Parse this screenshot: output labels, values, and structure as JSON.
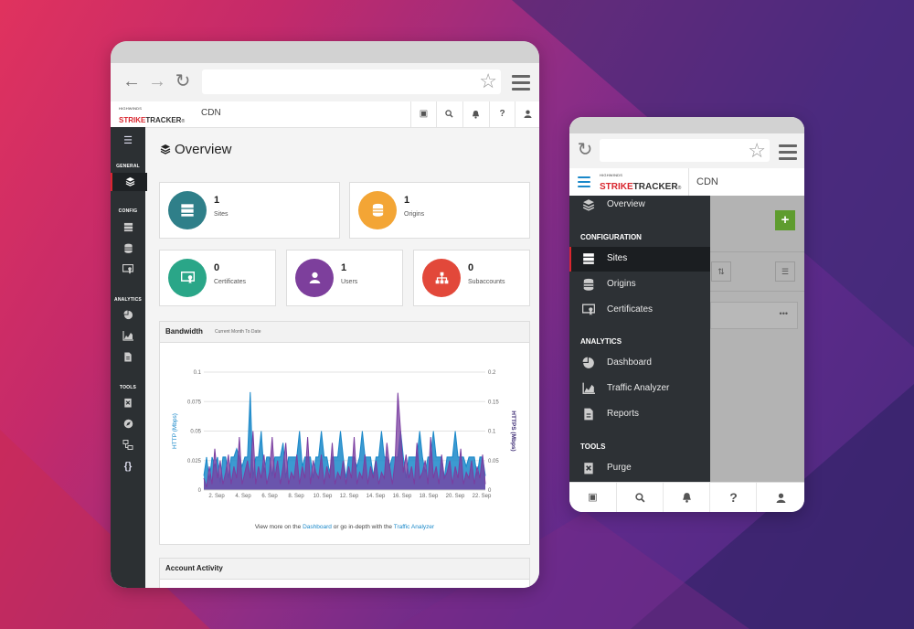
{
  "brand": {
    "small_text": "HIGHWINDS",
    "strike": "STRIKE",
    "tracker": "TRACKER",
    "reg": "®",
    "accent_color": "#d9262e"
  },
  "desktop": {
    "header": {
      "section": "CDN"
    },
    "sidebar": {
      "sections": {
        "general": "GENERAL",
        "config": "CONFIG",
        "analytics": "ANALYTICS",
        "tools": "TOOLS"
      },
      "tools_braces": "{}"
    },
    "page_title": "Overview",
    "stats": [
      {
        "count": "1",
        "label": "Sites",
        "color": "#2f7f89"
      },
      {
        "count": "1",
        "label": "Origins",
        "color": "#f3a535"
      },
      {
        "count": "0",
        "label": "Certificates",
        "color": "#2aa688"
      },
      {
        "count": "1",
        "label": "Users",
        "color": "#7d3f9c"
      },
      {
        "count": "0",
        "label": "Subaccounts",
        "color": "#e2483a"
      }
    ],
    "bandwidth": {
      "title": "Bandwidth",
      "subtitle": "Current Month To Date",
      "footer_prefix": "View more on the ",
      "footer_link1": "Dashboard",
      "footer_middle": " or go in-depth with the ",
      "footer_link2": "Traffic Analyzer"
    },
    "account_activity": {
      "title": "Account Activity"
    }
  },
  "chart_data": {
    "type": "line",
    "title": "",
    "ylabel": "HTTP (Mbps)",
    "y2label": "HTTPS (Mbps)",
    "ylim": [
      0,
      0.1
    ],
    "y2lim": [
      0,
      0.2
    ],
    "yticks": [
      "0",
      "0.025",
      "0.05",
      "0.075",
      "0.1"
    ],
    "y2ticks": [
      "0",
      "0.05",
      "0.1",
      "0.15",
      "0.2"
    ],
    "xticks": [
      "2. Sep",
      "4. Sep",
      "6. Sep",
      "8. Sep",
      "10. Sep",
      "12. Sep",
      "14. Sep",
      "16. Sep",
      "18. Sep",
      "20. Sep",
      "22. Sep"
    ],
    "series": [
      {
        "name": "HTTP (Mbps)",
        "color": "#1a88c9",
        "values": [
          0.012,
          0.028,
          0.008,
          0.028,
          0.02,
          0.028,
          0.006,
          0.028,
          0.028,
          0.01,
          0.028,
          0.028,
          0.035,
          0.028,
          0.02,
          0.028,
          0.028,
          0.083,
          0.01,
          0.028,
          0.028,
          0.05,
          0.015,
          0.028,
          0.028,
          0.012,
          0.028,
          0.028,
          0.028,
          0.04,
          0.01,
          0.028,
          0.028,
          0.028,
          0.028,
          0.05,
          0.02,
          0.028,
          0.028,
          0.028,
          0.01,
          0.028,
          0.028,
          0.05,
          0.028,
          0.028,
          0.015,
          0.028,
          0.028,
          0.028,
          0.05,
          0.028,
          0.01,
          0.028,
          0.028,
          0.028,
          0.02,
          0.028,
          0.05,
          0.028,
          0.028,
          0.028,
          0.012,
          0.028,
          0.028,
          0.05,
          0.028,
          0.028,
          0.02,
          0.028,
          0.028,
          0.028,
          0.05,
          0.028,
          0.01,
          0.028,
          0.028,
          0.028,
          0.028,
          0.05,
          0.028,
          0.015,
          0.028,
          0.028,
          0.05,
          0.028,
          0.028,
          0.028,
          0.01,
          0.028,
          0.028,
          0.028,
          0.05,
          0.028,
          0.028,
          0.028,
          0.02,
          0.028,
          0.028,
          0.028,
          0.012,
          0.028,
          0.028,
          0.012
        ]
      },
      {
        "name": "HTTPS (Mbps)",
        "color": "#7a3ea0",
        "values": [
          0.02,
          0.005,
          0.04,
          0.01,
          0.07,
          0.02,
          0.05,
          0.01,
          0.03,
          0.06,
          0.01,
          0.04,
          0.02,
          0.09,
          0.01,
          0.03,
          0.05,
          0.02,
          0.1,
          0.01,
          0.04,
          0.02,
          0.06,
          0.01,
          0.03,
          0.09,
          0.02,
          0.05,
          0.01,
          0.04,
          0.08,
          0.01,
          0.03,
          0.02,
          0.06,
          0.01,
          0.04,
          0.02,
          0.09,
          0.01,
          0.05,
          0.03,
          0.02,
          0.06,
          0.01,
          0.04,
          0.02,
          0.08,
          0.01,
          0.03,
          0.02,
          0.05,
          0.01,
          0.04,
          0.02,
          0.09,
          0.01,
          0.03,
          0.02,
          0.06,
          0.01,
          0.04,
          0.02,
          0.05,
          0.01,
          0.03,
          0.02,
          0.08,
          0.04,
          0.01,
          0.05,
          0.165,
          0.1,
          0.03,
          0.06,
          0.02,
          0.04,
          0.01,
          0.08,
          0.02,
          0.03,
          0.05,
          0.01,
          0.09,
          0.02,
          0.04,
          0.01,
          0.06,
          0.02,
          0.03,
          0.05,
          0.01,
          0.04,
          0.02,
          0.07,
          0.01,
          0.03,
          0.02,
          0.05,
          0.01,
          0.04,
          0.02,
          0.06,
          0.01
        ]
      }
    ],
    "legend": "none"
  },
  "mobile": {
    "header": {
      "section": "CDN"
    },
    "menu": [
      {
        "label": "Overview",
        "icon": "layers-icon"
      },
      {
        "section": "CONFIGURATION"
      },
      {
        "label": "Sites",
        "icon": "server-icon",
        "active": true
      },
      {
        "label": "Origins",
        "icon": "database-icon"
      },
      {
        "label": "Certificates",
        "icon": "certificate-icon"
      },
      {
        "section": "ANALYTICS"
      },
      {
        "label": "Dashboard",
        "icon": "pie-chart-icon"
      },
      {
        "label": "Traffic Analyzer",
        "icon": "area-chart-icon"
      },
      {
        "label": "Reports",
        "icon": "document-icon"
      },
      {
        "section": "TOOLS"
      },
      {
        "label": "Purge",
        "icon": "purge-icon"
      }
    ],
    "background_more": "•••"
  }
}
